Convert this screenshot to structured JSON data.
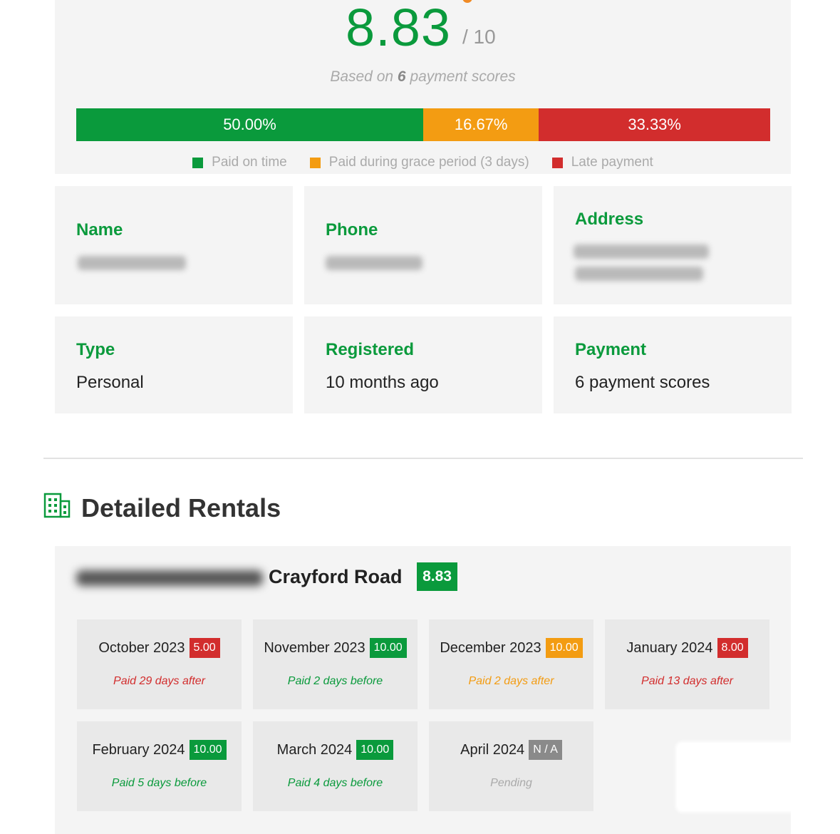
{
  "summary": {
    "score": "8.83",
    "score_max": "/ 10",
    "based_on_prefix": "Based on",
    "based_on_count": "6",
    "based_on_suffix": "payment scores",
    "distribution": [
      {
        "label": "50.00%",
        "fraction": 0.5,
        "color": "#0a9a3c"
      },
      {
        "label": "16.67%",
        "fraction": 0.1667,
        "color": "#f39c12"
      },
      {
        "label": "33.33%",
        "fraction": 0.3333,
        "color": "#d22d2d"
      }
    ],
    "legend": [
      {
        "label": "Paid on time",
        "color": "#0a9a3c"
      },
      {
        "label": "Paid during grace period (3 days)",
        "color": "#f39c12"
      },
      {
        "label": "Late payment",
        "color": "#d22d2d"
      }
    ]
  },
  "info": {
    "name_label": "Name",
    "phone_label": "Phone",
    "address_label": "Address",
    "type_label": "Type",
    "type_value": "Personal",
    "registered_label": "Registered",
    "registered_value": "10 months ago",
    "payment_label": "Payment",
    "payment_value": "6 payment scores"
  },
  "rentals": {
    "section_title": "Detailed Rentals",
    "property_name": "Crayford Road",
    "property_score": "8.83",
    "months": [
      {
        "month": "October 2023",
        "score": "5.00",
        "status": "red",
        "note": "Paid 29 days after"
      },
      {
        "month": "November 2023",
        "score": "10.00",
        "status": "green",
        "note": "Paid 2 days before"
      },
      {
        "month": "December 2023",
        "score": "10.00",
        "status": "orange",
        "note": "Paid 2 days after"
      },
      {
        "month": "January 2024",
        "score": "8.00",
        "status": "red",
        "note": "Paid 13 days after"
      },
      {
        "month": "February 2024",
        "score": "10.00",
        "status": "green",
        "note": "Paid 5 days before"
      },
      {
        "month": "March 2024",
        "score": "10.00",
        "status": "green",
        "note": "Paid 4 days before"
      },
      {
        "month": "April 2024",
        "score": "N / A",
        "status": "gray",
        "note": "Pending"
      }
    ]
  },
  "colors": {
    "brand_green": "#0a9a3c",
    "warning_orange": "#f39c12",
    "danger_red": "#d22d2d",
    "neutral_gray": "#8a8a8a"
  },
  "icons": {
    "section_icon": "building-icon"
  }
}
